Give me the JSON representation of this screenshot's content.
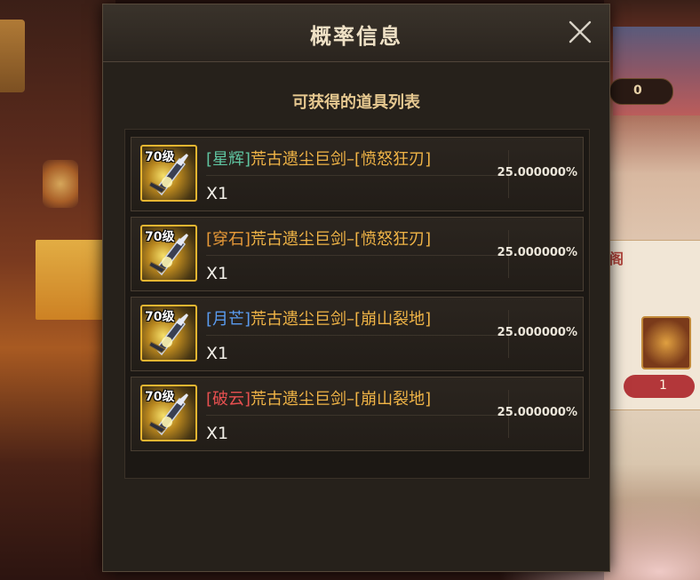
{
  "background": {
    "top_counter": "0",
    "side_label": "阁",
    "side_count": "1"
  },
  "dialog": {
    "title": "概率信息",
    "subtitle": "可获得的道具列表",
    "close_icon": "close-x-icon",
    "items": [
      {
        "level": "70级",
        "prefix": "[星辉]",
        "prefix_color": "#5fc4a0",
        "name": "荒古遗尘巨剑–[愤怒狂刃]",
        "qty": "X1",
        "rate": "25.000000%"
      },
      {
        "level": "70级",
        "prefix": "[穿石]",
        "prefix_color": "#e89a38",
        "name": "荒古遗尘巨剑–[愤怒狂刃]",
        "qty": "X1",
        "rate": "25.000000%"
      },
      {
        "level": "70级",
        "prefix": "[月芒]",
        "prefix_color": "#5a9cf0",
        "name": "荒古遗尘巨剑–[崩山裂地]",
        "qty": "X1",
        "rate": "25.000000%"
      },
      {
        "level": "70级",
        "prefix": "[破云]",
        "prefix_color": "#e85050",
        "name": "荒古遗尘巨剑–[崩山裂地]",
        "qty": "X1",
        "rate": "25.000000%"
      }
    ]
  },
  "colors": {
    "name_gold": "#f0b446",
    "icon_border": "#e8b631",
    "dialog_bg": "#26211b"
  }
}
